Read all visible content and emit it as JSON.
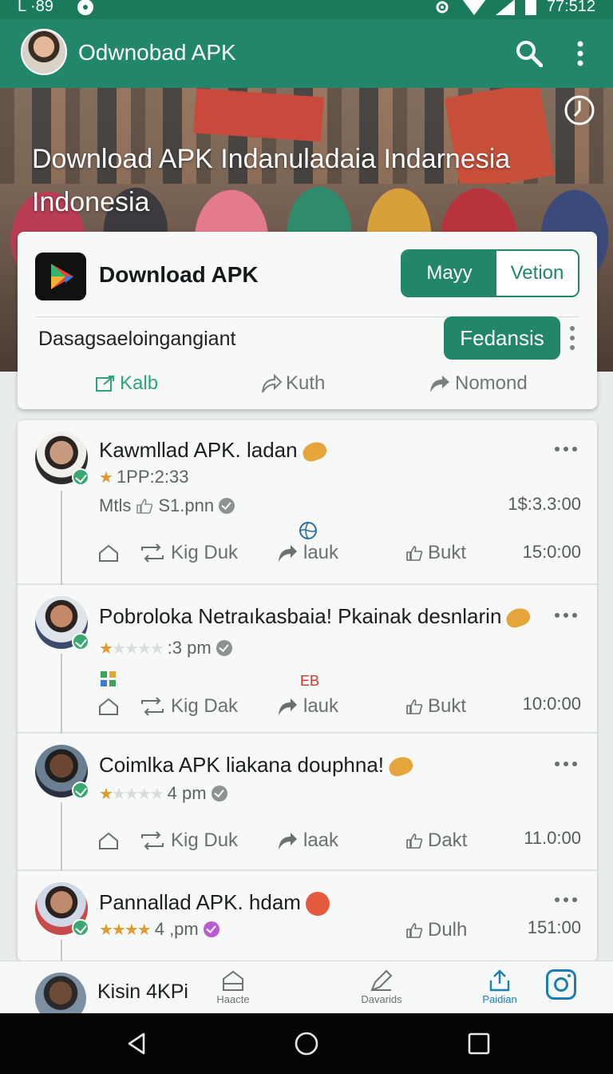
{
  "status_bar": {
    "left_text": "L ·89",
    "time": "77:512"
  },
  "app_bar": {
    "title": "Odwnobad APK"
  },
  "hero": {
    "title": "Download APK Indanuladaia Indarnesia Indonesia"
  },
  "app_card": {
    "name": "Download APK",
    "segments": [
      "Mayy",
      "Vetion"
    ],
    "subtitle": "Dasagsaeloingangiant",
    "primary_button": "Fedansis",
    "actions": [
      "Kalb",
      "Kuth",
      "Nomond"
    ]
  },
  "posts": [
    {
      "title": "Kawmllad APK. ladan",
      "rating_text": "1PP:2:33",
      "meta_a": "Mtls",
      "meta_b": "S1.pnn",
      "time": "1$:3.3:00",
      "actions": [
        "Kig Duk",
        "lauk",
        "Bukt"
      ],
      "action_time": "15:0:00"
    },
    {
      "title": "Pobroloka Netraıkasbaia! Pkainak desnlarin",
      "meta_b": ":3 pm",
      "badge": "EB",
      "actions": [
        "Kig Dak",
        "lauk",
        "Bukt"
      ],
      "action_time": "10:0:00"
    },
    {
      "title": "Coimlka APK liakana douphna!",
      "meta_b": "4 pm",
      "actions": [
        "Kig Duk",
        "laak",
        "Dakt"
      ],
      "action_time": "11.0:00"
    },
    {
      "title": "Pannallad APK. hdam",
      "meta_b": "4 ,pm",
      "actions": [
        "Dulh"
      ],
      "action_time": "151:00"
    }
  ],
  "bottom_nav": {
    "user_label": "Kisin 4KPi",
    "items": [
      "Haacte",
      "Davarids",
      "Paidian"
    ]
  },
  "colors": {
    "primary": "#22876a",
    "accent": "#1b7fb0",
    "star": "#e09a2e"
  }
}
